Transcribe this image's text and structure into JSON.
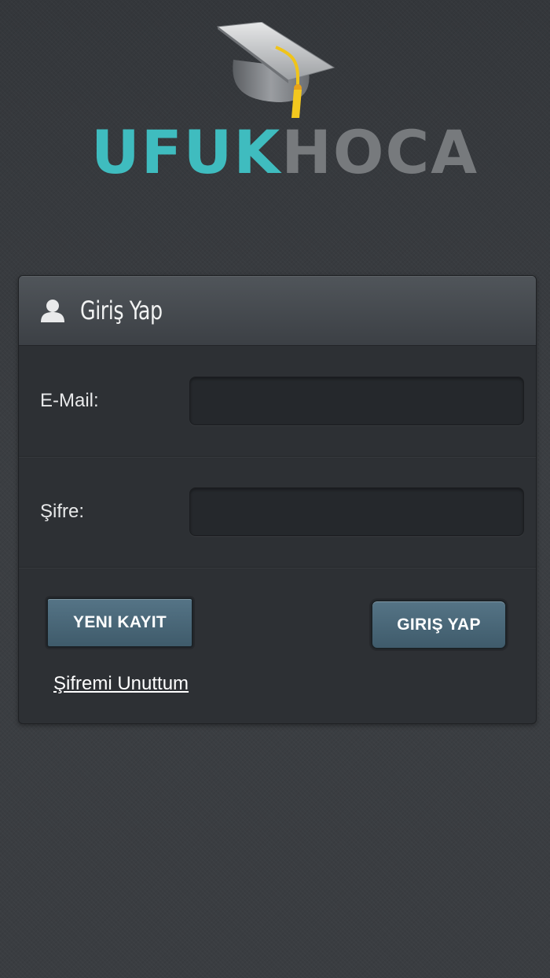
{
  "logo": {
    "part1": "UFUK",
    "part2": "HOCA",
    "icon": "graduation-cap-icon",
    "colors": {
      "part1": "#3fbcbf",
      "part2": "#777a7d",
      "tassel": "#f0c419"
    }
  },
  "login_panel": {
    "icon": "user-icon",
    "title": "Giriş Yap",
    "fields": {
      "email": {
        "label": "E-Mail:",
        "value": "",
        "placeholder": ""
      },
      "password": {
        "label": "Şifre:",
        "value": "",
        "placeholder": ""
      }
    },
    "buttons": {
      "register": "YENI KAYIT",
      "login": "GIRIŞ YAP"
    },
    "forgot_password_link": "Şifremi Unuttum"
  },
  "theme": {
    "background": "#393c40",
    "button": "#4a6778",
    "accent": "#3fbcbf"
  }
}
